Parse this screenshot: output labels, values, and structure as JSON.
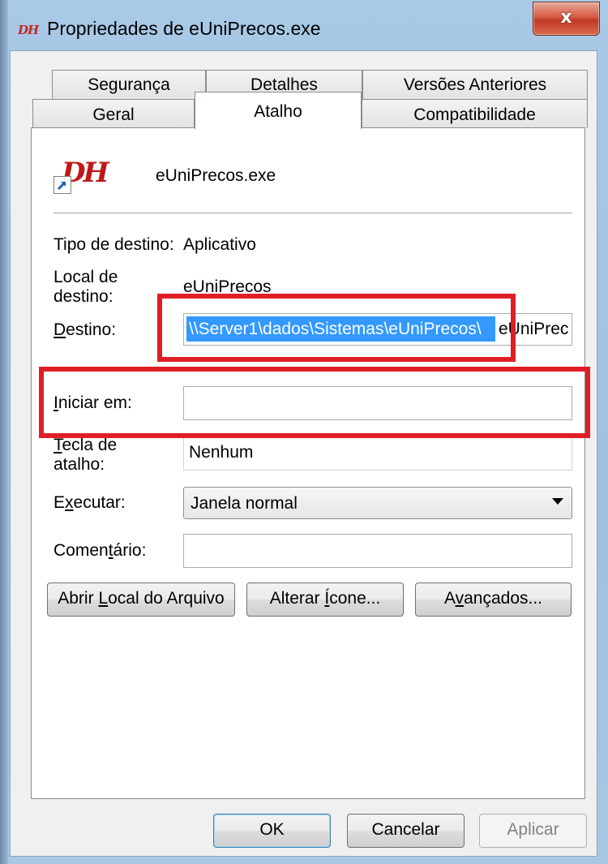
{
  "window": {
    "title": "Propriedades de eUniPrecos.exe",
    "app_icon_text": "DH",
    "close_glyph": "x"
  },
  "tabs": {
    "row1": [
      "Segurança",
      "Detalhes",
      "Versões Anteriores"
    ],
    "row2": [
      "Geral",
      "Atalho",
      "Compatibilidade"
    ],
    "active": "Atalho"
  },
  "shortcut": {
    "file_name": "eUniPrecos.exe",
    "icon_text": "DH",
    "fields": {
      "target_type_label": "Tipo de destino:",
      "target_type_value": "Aplicativo",
      "target_location_label": "Local de destino:",
      "target_location_value": "eUniPrecos",
      "target_label": "Destino:",
      "target_value_selected": "\\\\Server1\\dados\\Sistemas\\eUniPrecos\\",
      "target_value_rest": "eUniPrec",
      "start_in_label": "Iniciar em:",
      "start_in_value": "",
      "hotkey_label": "Tecla de atalho:",
      "hotkey_value": "Nenhum",
      "run_label": "Executar:",
      "run_value": "Janela normal",
      "comment_label": "Comentário:",
      "comment_value": ""
    },
    "buttons": {
      "open_location": "Abrir Local do Arquivo",
      "change_icon": "Alterar Ícone...",
      "advanced": "Avançados..."
    }
  },
  "footer": {
    "ok": "OK",
    "cancel": "Cancelar",
    "apply": "Aplicar"
  },
  "colors": {
    "highlight_box": "#e01e26",
    "selection": "#3399ff"
  }
}
